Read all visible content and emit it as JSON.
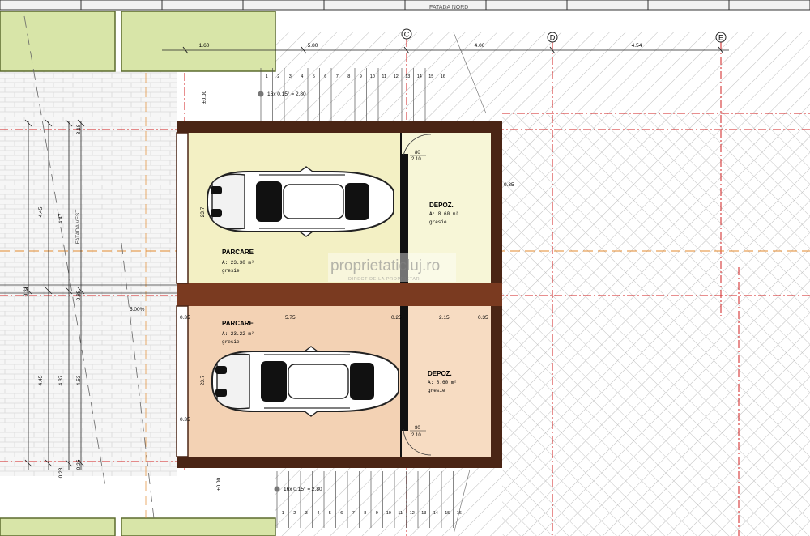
{
  "colors": {
    "wall": "#4a2515",
    "wall_mid": "#7a3a20",
    "garage_top_fill": "#f3f0c4",
    "storage_top_fill": "#f7f6d7",
    "garage_bottom_fill": "#f3d2b4",
    "storage_bottom_fill": "#f7dcc2",
    "green_slab": "#d8e5a8",
    "green_slab_edge": "#5c6b2e",
    "axis_red": "#d21f1f",
    "axis_orange": "#e38a2e",
    "hatch": "#b9b9b9",
    "dim_line": "#222222"
  },
  "header": {
    "facade_label": "FATADA NORD"
  },
  "axes": [
    {
      "id": "C"
    },
    {
      "id": "D"
    },
    {
      "id": "E"
    }
  ],
  "top_dimensions": [
    "1.60",
    "5.80",
    "4.00",
    "4.54"
  ],
  "rooms": {
    "parking_top": {
      "name": "PARCARE",
      "area": "A: 23.30  m²",
      "finish": "gresie"
    },
    "storage_top": {
      "name": "DEPOZ.",
      "area": "A: 8.60  m²",
      "finish": "gresie"
    },
    "parking_bottom": {
      "name": "PARCARE",
      "area": "A: 23.22  m²",
      "finish": "gresie"
    },
    "storage_bottom": {
      "name": "DEPOZ.",
      "area": "A: 8.60  m²",
      "finish": "gresie"
    }
  },
  "doors": {
    "top": {
      "width": "80",
      "height": "2.10"
    },
    "bottom": {
      "width": "80",
      "height": "2.10"
    }
  },
  "mid_dimensions": [
    "0.35",
    "5.75",
    "0.25",
    "2.15",
    "0.35"
  ],
  "side_labels": {
    "right_wall": "0.35",
    "left_top": "4.45",
    "left_top_2": "4.47",
    "left_top_3": "3.18",
    "left_bottom": "4.45",
    "left_bottom_2": "4.37",
    "left_bottom_3": "4.53",
    "garage_depth_top": "23.7",
    "garage_depth_bottom": "23.7",
    "facade_west": "FATADA VEST",
    "slope": "5.00%",
    "wall_035_a": "0.35",
    "wall_035_b": "0.35",
    "small_a": "0.85",
    "small_b": "0.31",
    "bottom_a": "0.23",
    "bottom_b": "0.25"
  },
  "stairs": {
    "top": {
      "label": "16x 0.15° = 2.80",
      "numbers": [
        "1",
        "2",
        "3",
        "4",
        "5",
        "6",
        "7",
        "8",
        "9",
        "10",
        "11",
        "12",
        "13",
        "14",
        "15",
        "16"
      ]
    },
    "bottom": {
      "label": "16x 0.15° = 2.80",
      "numbers": [
        "1",
        "2",
        "3",
        "4",
        "5",
        "6",
        "7",
        "8",
        "9",
        "10",
        "11",
        "12",
        "13",
        "14",
        "15",
        "16"
      ]
    }
  },
  "level_tags": {
    "top": "±0.00",
    "bottom": "±0.00"
  },
  "watermark": {
    "brand": "proprietaticluj.ro",
    "tagline": "DIRECT DE LA PROPRIETAR"
  }
}
